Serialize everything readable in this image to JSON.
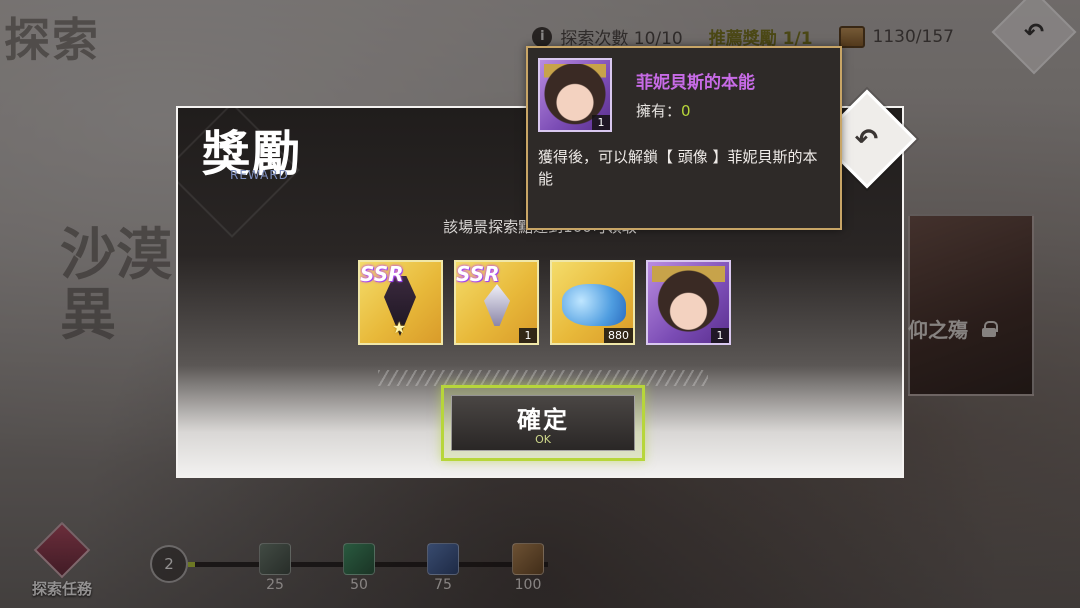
{
  "scene": {
    "title": "探索",
    "stage_title": "沙漠\n異",
    "stage_card_label": "仰之殤"
  },
  "top_bar": {
    "explore_count": "探索次數 10/10",
    "recommended_reward": "推薦獎勵 1/1",
    "currency": "1130/157"
  },
  "bottom": {
    "task_label": "探索任務",
    "level": "2",
    "progress": 0.02,
    "milestones": [
      "25",
      "50",
      "75",
      "100"
    ]
  },
  "dialog": {
    "title": "獎勵",
    "subtitle": "REWARD",
    "message": "該場景探索點達到100可領取",
    "items": [
      {
        "badge": "SSR",
        "qty": "",
        "star": "★",
        "art": "tie",
        "color": "gold"
      },
      {
        "badge": "SSR",
        "qty": "1",
        "star": "",
        "art": "pendant",
        "color": "gold"
      },
      {
        "badge": "",
        "qty": "880",
        "star": "",
        "art": "crystals",
        "color": "gold"
      },
      {
        "badge": "",
        "qty": "1",
        "star": "",
        "art": "avatar",
        "color": "purple"
      }
    ],
    "ok_label": "確定",
    "ok_sub": "OK"
  },
  "tooltip": {
    "name": "菲妮貝斯的本能",
    "owned_label": "擁有：",
    "owned_value": "0",
    "qty": "1",
    "description": "獲得後，可以解鎖【 頭像 】菲妮貝斯的本能"
  },
  "icons": {
    "back": "back-arrow-icon",
    "info": "info-icon",
    "chest": "treasure-chest-icon",
    "lock": "lock-icon"
  },
  "colors": {
    "accent_green": "#b7d63a",
    "tooltip_name": "#c76be6",
    "tooltip_border": "#c8a566"
  }
}
